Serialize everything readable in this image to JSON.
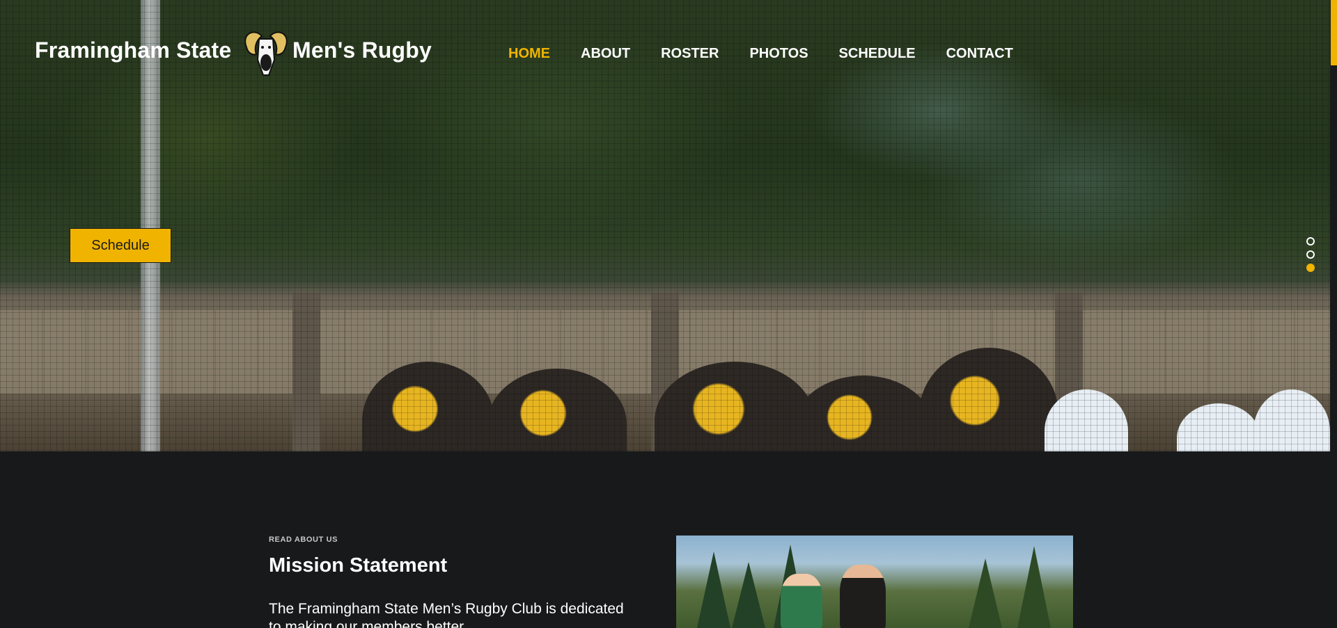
{
  "brand": {
    "left_text": "Framingham State",
    "right_text": "Men's Rugby",
    "logo_icon": "ram-head-logo"
  },
  "nav": {
    "items": [
      "HOME",
      "ABOUT",
      "ROSTER",
      "PHOTOS",
      "SCHEDULE",
      "CONTACT"
    ],
    "active": "HOME"
  },
  "hero": {
    "button_label": "Schedule",
    "slides_count": 3,
    "active_slide": 3
  },
  "about": {
    "kicker": "READ ABOUT US",
    "title": "Mission Statement",
    "body": "The Framingham State Men’s Rugby Club is dedicated to making our members better"
  },
  "colors": {
    "accent": "#f0b400",
    "background": "#18191b"
  }
}
